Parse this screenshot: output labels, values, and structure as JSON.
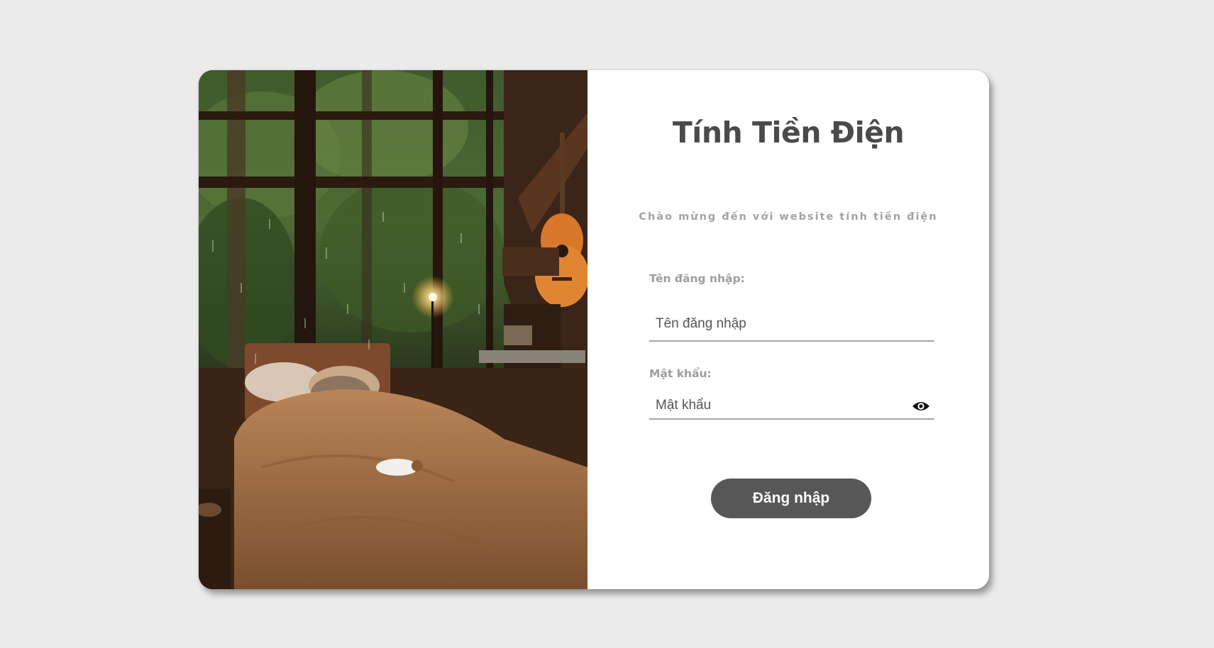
{
  "login": {
    "title": "Tính Tiền Điện",
    "subtitle": "Chào mừng đến với website tính tiền điện",
    "username_label": "Tên đăng nhập:",
    "username_placeholder": "Tên đăng nhập",
    "username_value": "",
    "password_label": "Mật khẩu:",
    "password_placeholder": "Mật khẩu",
    "password_value": "",
    "password_toggle_icon": "eye-icon",
    "submit_label": "Đăng nhập"
  },
  "colors": {
    "background": "#ebebeb",
    "card": "#ffffff",
    "title_text": "#4a4a4a",
    "muted_text": "#a3a3a3",
    "button": "#575757",
    "button_text": "#ffffff"
  }
}
